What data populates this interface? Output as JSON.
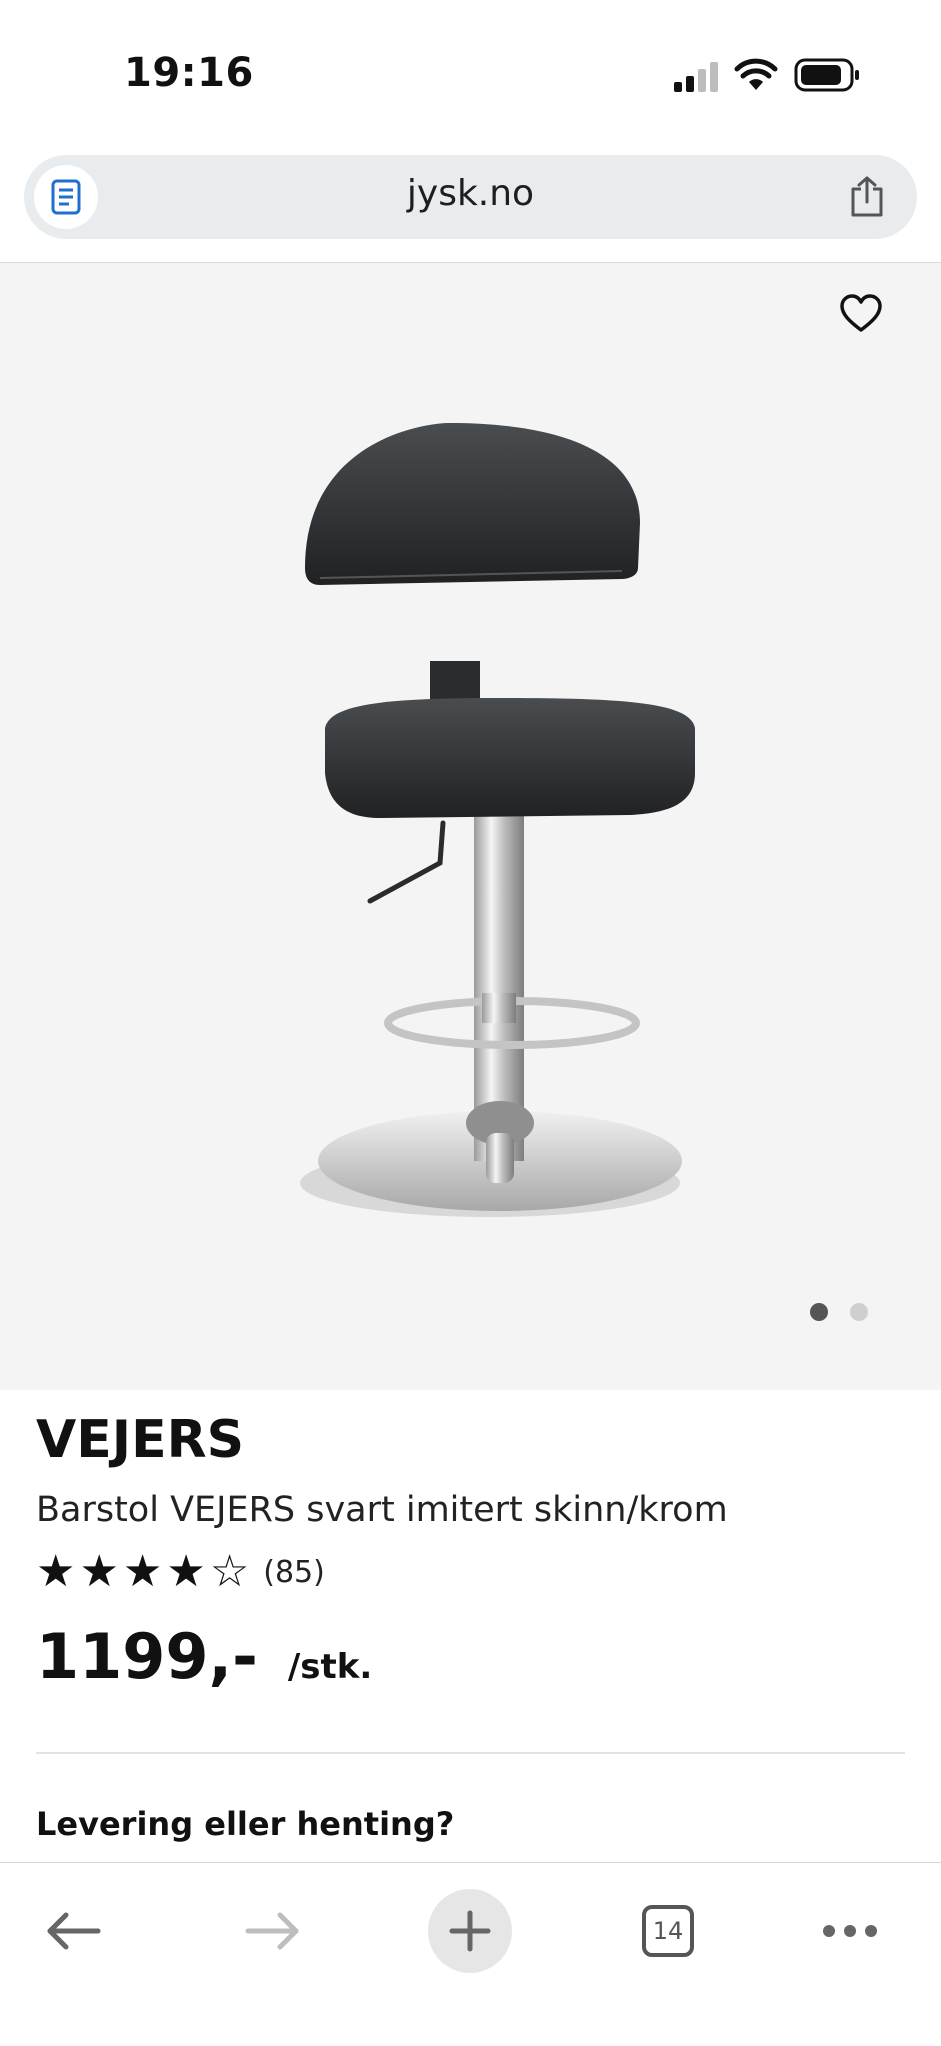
{
  "status_bar": {
    "time": "19:16"
  },
  "browser": {
    "url": "jysk.no"
  },
  "product": {
    "brand": "VEJERS",
    "description": "Barstol VEJERS svart imitert skinn/krom",
    "rating": {
      "stars_filled": 4,
      "stars_total": 5,
      "review_count": "(85)"
    },
    "price": "1199,-",
    "price_unit": "/stk.",
    "image_dots": {
      "total": 2,
      "active_index": 0
    }
  },
  "delivery": {
    "heading": "Levering eller henting?"
  },
  "toolbar": {
    "tab_count": "14"
  },
  "colors": {
    "accent": "#1f6fd1",
    "image_bg": "#f4f4f4",
    "text": "#111111"
  }
}
